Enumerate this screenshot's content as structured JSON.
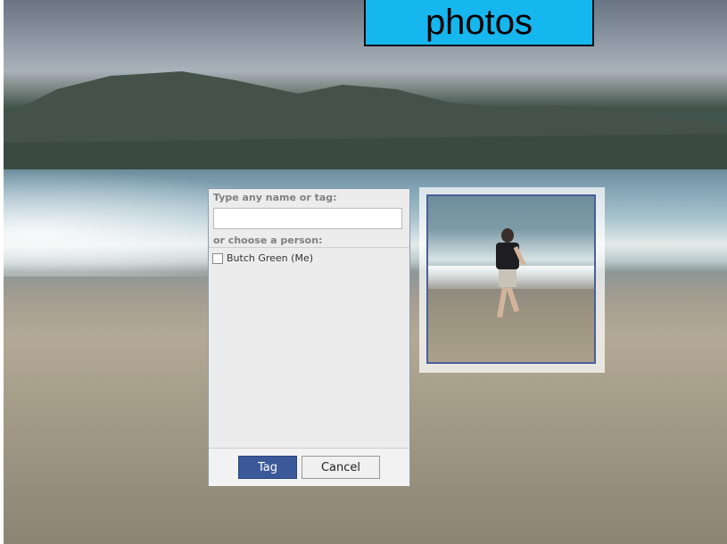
{
  "header": {
    "title": "photos"
  },
  "tag_dialog": {
    "search_label": "Type any name or tag:",
    "search_value": "",
    "choose_label": "or choose a person:",
    "people": [
      {
        "name": "Butch Green (Me)",
        "checked": false
      }
    ],
    "tag_button": "Tag",
    "cancel_button": "Cancel"
  },
  "colors": {
    "title_bg": "#16b6ee",
    "tag_button_bg": "#3b5998",
    "tag_frame_border": "#4a5f9a"
  }
}
